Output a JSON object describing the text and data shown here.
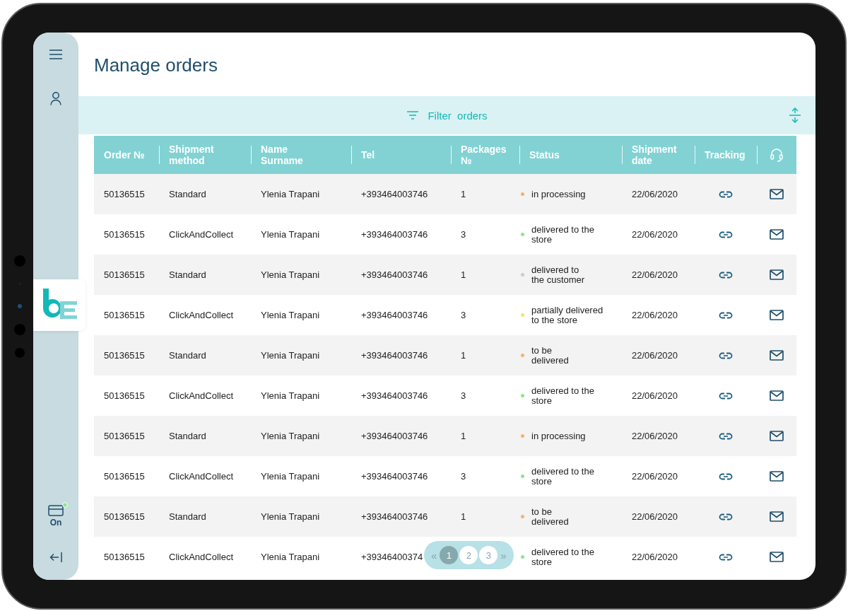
{
  "sidebar": {
    "connection": {
      "label": "On",
      "on": true
    }
  },
  "title": "Manage orders",
  "filter": {
    "label": "Filter  orders"
  },
  "table": {
    "columns": [
      "Order №",
      "Shipment method",
      "Name Surname",
      "Tel",
      "Packages №",
      "Status",
      "Shipment date",
      "Tracking"
    ],
    "rows": [
      {
        "order": "50136515",
        "method": "Standard",
        "name": "Ylenia Trapani",
        "tel": "+393464003746",
        "packages": "1",
        "status": "in processing",
        "color": "#f5b26b",
        "date": "22/06/2020"
      },
      {
        "order": "50136515",
        "method": "ClickAndCollect",
        "name": "Ylenia Trapani",
        "tel": "+393464003746",
        "packages": "3",
        "status": "delivered to the store",
        "color": "#8ee58a",
        "date": "22/06/2020"
      },
      {
        "order": "50136515",
        "method": "Standard",
        "name": "Ylenia Trapani",
        "tel": "+393464003746",
        "packages": "1",
        "status": "delivered to\nthe customer",
        "color": "#cccccc",
        "date": "22/06/2020"
      },
      {
        "order": "50136515",
        "method": "ClickAndCollect",
        "name": "Ylenia Trapani",
        "tel": "+393464003746",
        "packages": "3",
        "status": "partially delivered to the store",
        "color": "#f7e36b",
        "date": "22/06/2020"
      },
      {
        "order": "50136515",
        "method": "Standard",
        "name": "Ylenia Trapani",
        "tel": "+393464003746",
        "packages": "1",
        "status": "to be\ndelivered",
        "color": "#f5b26b",
        "date": "22/06/2020"
      },
      {
        "order": "50136515",
        "method": "ClickAndCollect",
        "name": "Ylenia Trapani",
        "tel": "+393464003746",
        "packages": "3",
        "status": "delivered to the store",
        "color": "#8ee58a",
        "date": "22/06/2020"
      },
      {
        "order": "50136515",
        "method": "Standard",
        "name": "Ylenia Trapani",
        "tel": "+393464003746",
        "packages": "1",
        "status": "in processing",
        "color": "#f5b26b",
        "date": "22/06/2020"
      },
      {
        "order": "50136515",
        "method": "ClickAndCollect",
        "name": "Ylenia Trapani",
        "tel": "+393464003746",
        "packages": "3",
        "status": "delivered to the store",
        "color": "#8ee58a",
        "date": "22/06/2020"
      },
      {
        "order": "50136515",
        "method": "Standard",
        "name": "Ylenia Trapani",
        "tel": "+393464003746",
        "packages": "1",
        "status": "to be\ndelivered",
        "color": "#f5b26b",
        "date": "22/06/2020"
      },
      {
        "order": "50136515",
        "method": "ClickAndCollect",
        "name": "Ylenia Trapani",
        "tel": "+39346400374",
        "status": "delivered to the store",
        "color": "#8ee58a",
        "date": "22/06/2020"
      }
    ]
  },
  "pagination": {
    "prev": "«",
    "next": "»",
    "pages": [
      {
        "label": "1",
        "selected": true
      },
      {
        "label": "2",
        "selected": false
      },
      {
        "label": "3",
        "selected": false
      }
    ]
  }
}
